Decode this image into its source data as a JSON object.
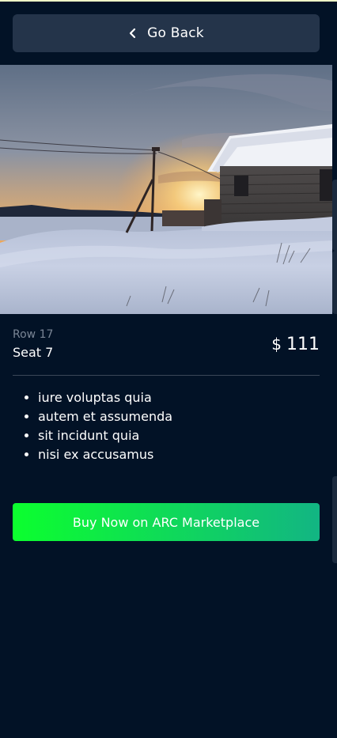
{
  "nav": {
    "back_label": "Go Back",
    "back_icon": "chevron-left-icon"
  },
  "ticket": {
    "image_alt": "Snowy landscape at sunset with a wooden cabin and a utility pole",
    "row": "Row 17",
    "seat": "Seat 7",
    "currency": "$",
    "price": "111"
  },
  "features": [
    "iure voluptas quia",
    "autem et assumenda",
    "sit incidunt quia",
    "nisi ex accusamus"
  ],
  "actions": {
    "buy_label": "Buy Now on ARC Marketplace"
  },
  "colors": {
    "background": "#021226",
    "back_button": "#24344a",
    "buy_gradient_start": "#0cff2e",
    "buy_gradient_end": "#12b583"
  }
}
